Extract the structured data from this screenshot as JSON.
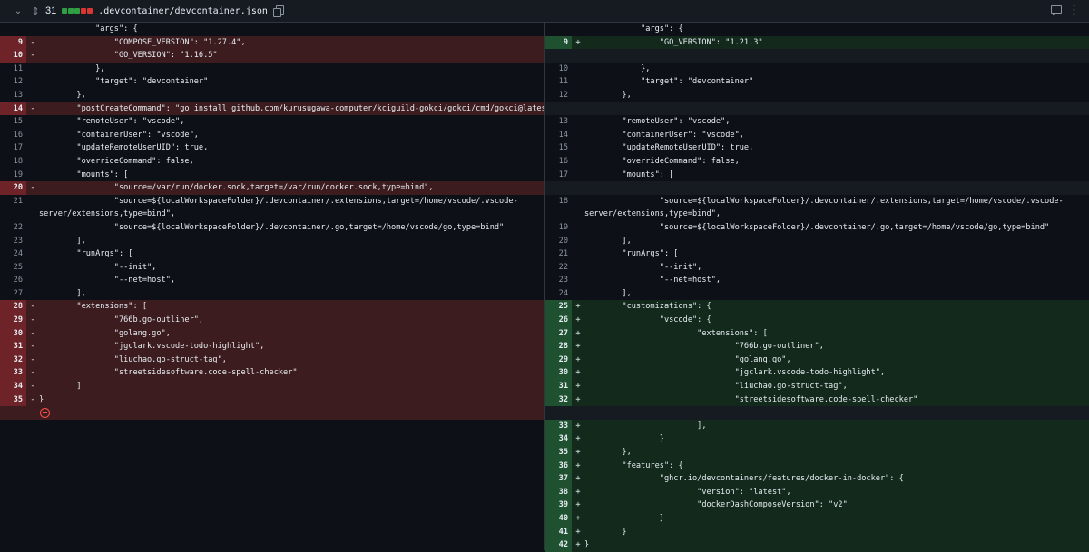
{
  "header": {
    "changes_count": "31",
    "file_path": ".devcontainer/devcontainer.json",
    "block_colors": [
      "#2ea043",
      "#2ea043",
      "#2ea043",
      "#da3633",
      "#da3633"
    ]
  },
  "left_rows": [
    {
      "type": "context",
      "ln": "",
      "code": "            \"args\": {"
    },
    {
      "type": "del",
      "ln": "9",
      "mk": "-",
      "code": "                \"COMPOSE_VERSION\": \"1.27.4\","
    },
    {
      "type": "del",
      "ln": "10",
      "mk": "-",
      "code": "                \"GO_VERSION\": \"1.16.5\""
    },
    {
      "type": "context",
      "ln": "11",
      "code": "            },"
    },
    {
      "type": "context",
      "ln": "12",
      "code": "            \"target\": \"devcontainer\""
    },
    {
      "type": "context",
      "ln": "13",
      "code": "        },"
    },
    {
      "type": "del",
      "ln": "14",
      "mk": "-",
      "code": "        \"postCreateCommand\": \"go install github.com/kurusugawa-computer/kciguild-gokci/gokci/cmd/gokci@latest\","
    },
    {
      "type": "context",
      "ln": "15",
      "code": "        \"remoteUser\": \"vscode\","
    },
    {
      "type": "context",
      "ln": "16",
      "code": "        \"containerUser\": \"vscode\","
    },
    {
      "type": "context",
      "ln": "17",
      "code": "        \"updateRemoteUserUID\": true,"
    },
    {
      "type": "context",
      "ln": "18",
      "code": "        \"overrideCommand\": false,"
    },
    {
      "type": "context",
      "ln": "19",
      "code": "        \"mounts\": ["
    },
    {
      "type": "del",
      "ln": "20",
      "mk": "-",
      "code": "                \"source=/var/run/docker.sock,target=/var/run/docker.sock,type=bind\","
    },
    {
      "type": "context",
      "ln": "21",
      "code": "                \"source=${localWorkspaceFolder}/.devcontainer/.extensions,target=/home/vscode/.vscode-"
    },
    {
      "type": "context",
      "ln": "",
      "code": "server/extensions,type=bind\","
    },
    {
      "type": "context",
      "ln": "22",
      "code": "                \"source=${localWorkspaceFolder}/.devcontainer/.go,target=/home/vscode/go,type=bind\""
    },
    {
      "type": "context",
      "ln": "23",
      "code": "        ],"
    },
    {
      "type": "context",
      "ln": "24",
      "code": "        \"runArgs\": ["
    },
    {
      "type": "context",
      "ln": "25",
      "code": "                \"--init\","
    },
    {
      "type": "context",
      "ln": "26",
      "code": "                \"--net=host\","
    },
    {
      "type": "context",
      "ln": "27",
      "code": "        ],"
    },
    {
      "type": "del",
      "ln": "28",
      "mk": "-",
      "code": "        \"extensions\": ["
    },
    {
      "type": "del",
      "ln": "29",
      "mk": "-",
      "code": "                \"766b.go-outliner\","
    },
    {
      "type": "del",
      "ln": "30",
      "mk": "-",
      "code": "                \"golang.go\","
    },
    {
      "type": "del",
      "ln": "31",
      "mk": "-",
      "code": "                \"jgclark.vscode-todo-highlight\","
    },
    {
      "type": "del",
      "ln": "32",
      "mk": "-",
      "code": "                \"liuchao.go-struct-tag\","
    },
    {
      "type": "del",
      "ln": "33",
      "mk": "-",
      "code": "                \"streetsidesoftware.code-spell-checker\""
    },
    {
      "type": "del",
      "ln": "34",
      "mk": "-",
      "code": "        ]"
    },
    {
      "type": "del",
      "ln": "35",
      "mk": "-",
      "code": "}"
    }
  ],
  "right_rows": [
    {
      "type": "context",
      "ln": "",
      "code": "            \"args\": {"
    },
    {
      "type": "add",
      "ln": "9",
      "mk": "+",
      "code": "                \"GO_VERSION\": \"1.21.3\""
    },
    {
      "type": "empty",
      "ln": "",
      "code": ""
    },
    {
      "type": "context",
      "ln": "10",
      "code": "            },"
    },
    {
      "type": "context",
      "ln": "11",
      "code": "            \"target\": \"devcontainer\""
    },
    {
      "type": "context",
      "ln": "12",
      "code": "        },"
    },
    {
      "type": "empty",
      "ln": "",
      "code": ""
    },
    {
      "type": "context",
      "ln": "13",
      "code": "        \"remoteUser\": \"vscode\","
    },
    {
      "type": "context",
      "ln": "14",
      "code": "        \"containerUser\": \"vscode\","
    },
    {
      "type": "context",
      "ln": "15",
      "code": "        \"updateRemoteUserUID\": true,"
    },
    {
      "type": "context",
      "ln": "16",
      "code": "        \"overrideCommand\": false,"
    },
    {
      "type": "context",
      "ln": "17",
      "code": "        \"mounts\": ["
    },
    {
      "type": "empty",
      "ln": "",
      "code": ""
    },
    {
      "type": "context",
      "ln": "18",
      "code": "                \"source=${localWorkspaceFolder}/.devcontainer/.extensions,target=/home/vscode/.vscode-"
    },
    {
      "type": "context",
      "ln": "",
      "code": "server/extensions,type=bind\","
    },
    {
      "type": "context",
      "ln": "19",
      "code": "                \"source=${localWorkspaceFolder}/.devcontainer/.go,target=/home/vscode/go,type=bind\""
    },
    {
      "type": "context",
      "ln": "20",
      "code": "        ],"
    },
    {
      "type": "context",
      "ln": "21",
      "code": "        \"runArgs\": ["
    },
    {
      "type": "context",
      "ln": "22",
      "code": "                \"--init\","
    },
    {
      "type": "context",
      "ln": "23",
      "code": "                \"--net=host\","
    },
    {
      "type": "context",
      "ln": "24",
      "code": "        ],"
    },
    {
      "type": "add",
      "ln": "25",
      "mk": "+",
      "code": "        \"customizations\": {"
    },
    {
      "type": "add",
      "ln": "26",
      "mk": "+",
      "code": "                \"vscode\": {"
    },
    {
      "type": "add",
      "ln": "27",
      "mk": "+",
      "code": "                        \"extensions\": ["
    },
    {
      "type": "add",
      "ln": "28",
      "mk": "+",
      "code": "                                \"766b.go-outliner\","
    },
    {
      "type": "add",
      "ln": "29",
      "mk": "+",
      "code": "                                \"golang.go\","
    },
    {
      "type": "add",
      "ln": "30",
      "mk": "+",
      "code": "                                \"jgclark.vscode-todo-highlight\","
    },
    {
      "type": "add",
      "ln": "31",
      "mk": "+",
      "code": "                                \"liuchao.go-struct-tag\","
    },
    {
      "type": "add",
      "ln": "32",
      "mk": "+",
      "code": "                                \"streetsidesoftware.code-spell-checker\""
    },
    {
      "type": "empty",
      "ln": "",
      "code": ""
    },
    {
      "type": "add",
      "ln": "33",
      "mk": "+",
      "code": "                        ],"
    },
    {
      "type": "add",
      "ln": "34",
      "mk": "+",
      "code": "                }"
    },
    {
      "type": "add",
      "ln": "35",
      "mk": "+",
      "code": "        },"
    },
    {
      "type": "add",
      "ln": "36",
      "mk": "+",
      "code": "        \"features\": {"
    },
    {
      "type": "add",
      "ln": "37",
      "mk": "+",
      "code": "                \"ghcr.io/devcontainers/features/docker-in-docker\": {"
    },
    {
      "type": "add",
      "ln": "38",
      "mk": "+",
      "code": "                        \"version\": \"latest\","
    },
    {
      "type": "add",
      "ln": "39",
      "mk": "+",
      "code": "                        \"dockerDashComposeVersion\": \"v2\""
    },
    {
      "type": "add",
      "ln": "40",
      "mk": "+",
      "code": "                }"
    },
    {
      "type": "add",
      "ln": "41",
      "mk": "+",
      "code": "        }"
    },
    {
      "type": "add",
      "ln": "42",
      "mk": "+",
      "code": "}"
    }
  ]
}
